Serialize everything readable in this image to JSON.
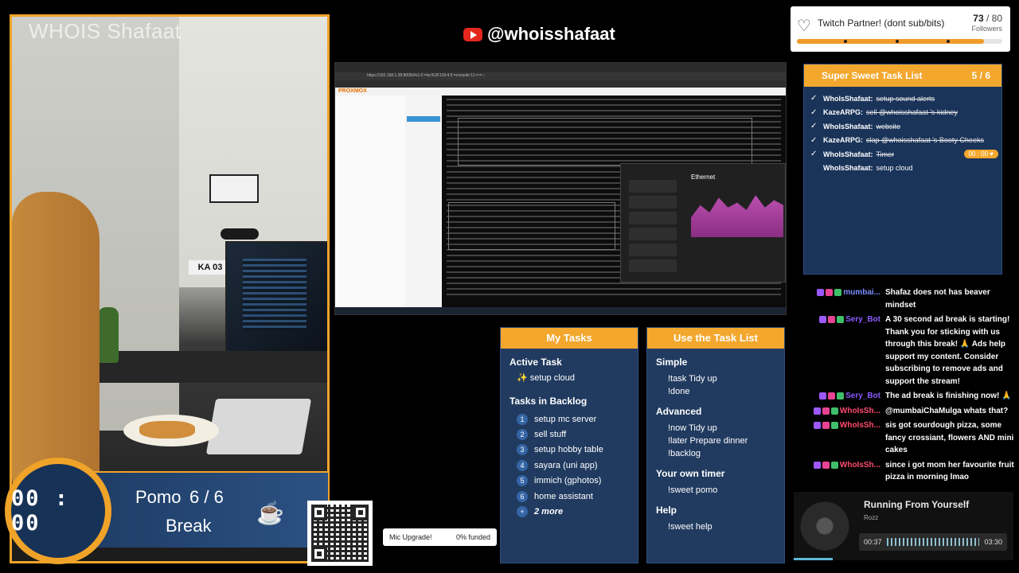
{
  "camera": {
    "watermark": "WHOIS Shafaat",
    "plate_text": "KA 03"
  },
  "pomo": {
    "time": "00 : 00",
    "label": "Pomo",
    "count": "6 / 6",
    "status": "Break",
    "icon": "coffee-cup-icon"
  },
  "mic_upgrade": {
    "label": "Mic Upgrade!",
    "funded": "0% funded"
  },
  "youtube": {
    "handle": "@whoisshafaat",
    "icon": "youtube-icon",
    "color": "#e4271d"
  },
  "screen": {
    "url": "https://192.168.1.38:8006/#v1:0:=lxc%2F118:4:5:=console:11:=:=:::",
    "app": "PROXMOX",
    "perf_title": "Ethernet"
  },
  "twitch": {
    "label": "Twitch Partner! (dont sub/bits)",
    "current": "73",
    "goal": "80",
    "unit": "Followers",
    "progress": 0.9125,
    "accent": "#f09a2a"
  },
  "task_list": {
    "title": "Super Sweet Task List",
    "count": "5 / 6",
    "items": [
      {
        "user": "WhoIsShafaat:",
        "task": "setup sound alerts",
        "done": true,
        "timer": ""
      },
      {
        "user": "KazeARPG:",
        "task": "sell @whoisshafaat 's kidney",
        "done": true,
        "timer": ""
      },
      {
        "user": "WhoIsShafaat:",
        "task": "website",
        "done": true,
        "timer": ""
      },
      {
        "user": "KazeARPG:",
        "task": "clap @whoisshafaat 's Booty Cheeks",
        "done": true,
        "timer": ""
      },
      {
        "user": "WhoIsShafaat:",
        "task": "Timer",
        "done": true,
        "timer": "00 : 00"
      },
      {
        "user": "WhoIsShafaat:",
        "task": "setup cloud",
        "done": false,
        "timer": ""
      }
    ]
  },
  "chat": [
    {
      "name": "mumbai...",
      "color": "#7b8cff",
      "text": "Shafaz does not has beaver mindset"
    },
    {
      "name": "Sery_Bot",
      "color": "#8a5cff",
      "text": "A 30 second ad break is starting! Thank you for sticking with us through this break! 🙏 Ads help support my content. Consider subscribing to remove ads and support the stream!"
    },
    {
      "name": "Sery_Bot",
      "color": "#8a5cff",
      "text": "The ad break is finishing now! 🙏"
    },
    {
      "name": "WhoIsSh...",
      "color": "#ff4a6e",
      "text": "@mumbaiChaMulga whats that?"
    },
    {
      "name": "WhoIsSh...",
      "color": "#ff4a6e",
      "text": "sis got sourdough pizza, some fancy crossiant, flowers AND mini cakes"
    },
    {
      "name": "WhoIsSh...",
      "color": "#ff4a6e",
      "text": "since i got mom her favourite fruit pizza in morning lmao"
    }
  ],
  "now_playing": {
    "title": "Running From Yourself",
    "artist": "Rozz",
    "elapsed": "00:37",
    "total": "03:30",
    "progress": 0.176
  },
  "my_tasks": {
    "title": "My Tasks",
    "active_title": "Active Task",
    "active": "✨ setup cloud",
    "backlog_title": "Tasks in Backlog",
    "backlog": [
      {
        "n": "1",
        "label": "setup mc server"
      },
      {
        "n": "2",
        "label": "sell stuff"
      },
      {
        "n": "3",
        "label": "setup hobby table"
      },
      {
        "n": "4",
        "label": "sayara (uni app)"
      },
      {
        "n": "5",
        "label": "immich (gphotos)"
      },
      {
        "n": "6",
        "label": "home assistant"
      },
      {
        "n": "+",
        "label": "2 more"
      }
    ]
  },
  "use_tasks": {
    "title": "Use the Task List",
    "simple_title": "Simple",
    "simple": [
      "!task Tidy up",
      "!done"
    ],
    "advanced_title": "Advanced",
    "advanced": [
      "!now Tidy up",
      "!later Prepare dinner",
      "!backlog"
    ],
    "timer_title": "Your own timer",
    "timer": [
      "!sweet pomo"
    ],
    "help_title": "Help",
    "help": [
      "!sweet help"
    ]
  }
}
